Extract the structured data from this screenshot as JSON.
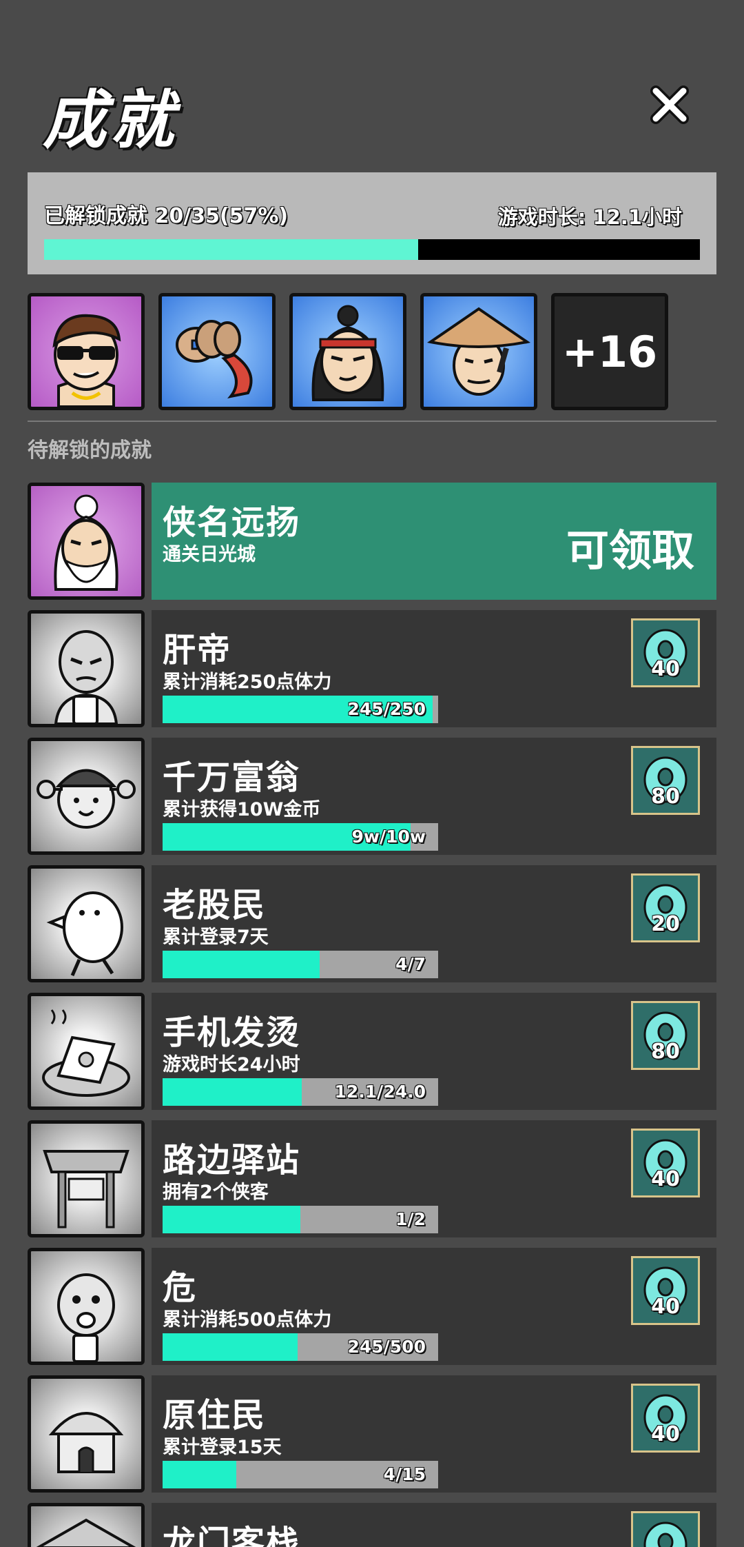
{
  "header": {
    "title": "成就"
  },
  "summary": {
    "unlocked_text": "已解锁成就 20/35(57%)",
    "playtime_text": "游戏时长: 12.1小时",
    "progress_fraction": 0.57
  },
  "unlocked_badges": [
    {
      "icon": "sunglasses-man-portrait",
      "color": "#c77fd3"
    },
    {
      "icon": "coin-string-icon",
      "color": "#5a9ff0"
    },
    {
      "icon": "headband-swordsman-portrait",
      "color": "#5a9ff0"
    },
    {
      "icon": "straw-hat-man-portrait",
      "color": "#5a9ff0"
    }
  ],
  "more_badges_label": "+16",
  "section_title": "待解锁的成就",
  "achievements": [
    {
      "name": "侠名远扬",
      "desc": "通关日光城",
      "claimable": true,
      "claim_label": "可领取",
      "icon": "old-master-portrait"
    },
    {
      "name": "肝帝",
      "desc": "累计消耗250点体力",
      "progress_text": "245/250",
      "progress": 0.98,
      "reward": "40",
      "icon": "tired-man-phone-portrait"
    },
    {
      "name": "千万富翁",
      "desc": "累计获得10W金币",
      "progress_text": "9w/10w",
      "progress": 0.9,
      "reward": "80",
      "icon": "rich-official-portrait"
    },
    {
      "name": "老股民",
      "desc": "累计登录7天",
      "progress_text": "4/7",
      "progress": 0.571,
      "reward": "20",
      "icon": "running-duck-portrait"
    },
    {
      "name": "手机发烫",
      "desc": "游戏时长24小时",
      "progress_text": "12.1/24.0",
      "progress": 0.504,
      "reward": "80",
      "icon": "hot-phone-icon"
    },
    {
      "name": "路边驿站",
      "desc": "拥有2个侠客",
      "progress_text": "1/2",
      "progress": 0.5,
      "reward": "40",
      "icon": "roadside-station-icon"
    },
    {
      "name": "危",
      "desc": "累计消耗500点体力",
      "progress_text": "245/500",
      "progress": 0.49,
      "reward": "40",
      "icon": "scared-man-portrait"
    },
    {
      "name": "原住民",
      "desc": "累计登录15天",
      "progress_text": "4/15",
      "progress": 0.267,
      "reward": "40",
      "icon": "hut-icon"
    },
    {
      "name": "龙门客栈",
      "icon": "inn-icon",
      "reward_icon": "jade-icon"
    }
  ]
}
